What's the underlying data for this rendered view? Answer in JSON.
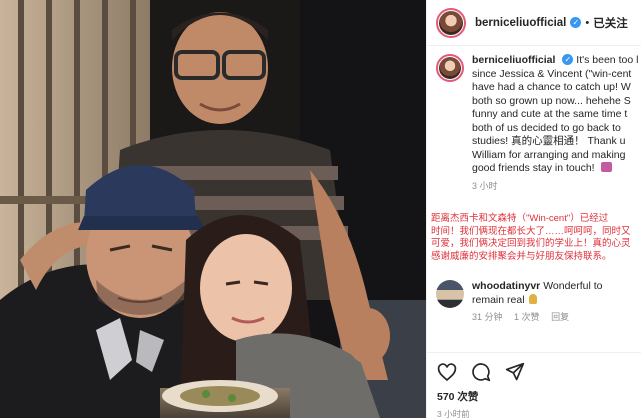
{
  "post": {
    "username": "berniceliuofficial",
    "verified_glyph": "✓",
    "separator": "•",
    "follow_label": "已关注"
  },
  "caption": {
    "username": "berniceliuofficial",
    "lines": [
      "It's been too l",
      "since Jessica & Vincent (\"win-cent",
      "have had a chance to catch up! W",
      "both so grown up now... hehehe S",
      "funny and cute at the same time t",
      "both of us decided to go back to",
      "studies! 真的心靈相通！ Thank u",
      "William for arranging and making",
      "good friends stay in touch!"
    ],
    "time": "3 小时"
  },
  "translation": {
    "lines": [
      "距离杰西卡和文森特（\"Win-cent\"）已经过",
      "时间！我们俩现在都长大了……呵呵呵，同时又",
      "可爱，我们俩决定回到我们的学业上！真的心灵",
      "感谢威廉的安排聚会并与好朋友保持联系。"
    ]
  },
  "comment": {
    "username": "whoodatinyvr",
    "text_line1": "Wonderful to",
    "text_line2": "remain real",
    "time": "31 分钟",
    "likes": "1 次赞",
    "reply": "回复"
  },
  "stats": {
    "likes": "570 次赞",
    "time_ago": "3 小时前"
  },
  "icons": {
    "like": "heart-icon",
    "comment": "comment-bubble-icon",
    "share": "paper-plane-icon",
    "emoji": "hands-emoji-icon"
  },
  "colors": {
    "verified": "#3897f0",
    "translation_text": "#e0303a",
    "story_ring": "#e4587a"
  }
}
